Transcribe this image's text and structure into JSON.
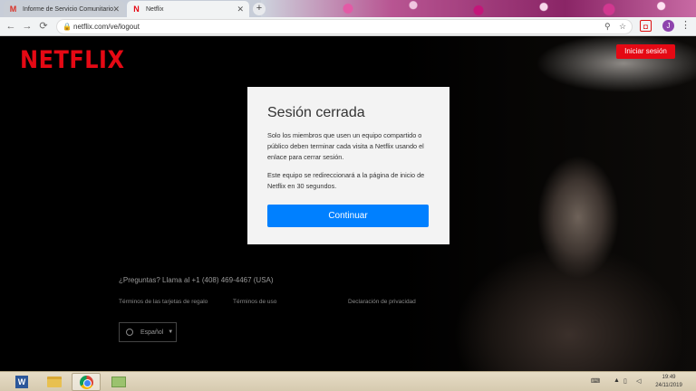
{
  "browser": {
    "tabs": [
      {
        "label": "Informe de Servicio Comunitario",
        "favicon": "M",
        "active": false
      },
      {
        "label": "Netflix",
        "favicon": "N",
        "active": true
      }
    ],
    "new_tab": "+",
    "url": "netflix.com/ve/logout",
    "nav": {
      "back": "←",
      "forward": "→",
      "reload": "⟳"
    },
    "icons": {
      "zoom": "⚲",
      "star": "☆",
      "menu": "⋮",
      "profile": "J"
    }
  },
  "page": {
    "logo": "NETFLIX",
    "signin_button": "Iniciar sesión",
    "card": {
      "title": "Sesión cerrada",
      "paragraph1": "Solo los miembros que usen un equipo compartido o público deben terminar cada visita a Netflix usando el enlace para cerrar sesión.",
      "paragraph2": "Este equipo se redireccionará a la página de inicio de Netflix en 30 segundos.",
      "button": "Continuar"
    },
    "footer": {
      "question": "¿Preguntas? Llama al +1 (408) 469-4467 (USA)",
      "links": [
        "Términos de las tarjetas de regalo",
        "Términos de uso",
        "Declaración de privacidad"
      ],
      "language": "Español"
    }
  },
  "taskbar": {
    "apps": [
      "word",
      "file-explorer",
      "chrome",
      "sticky-notes"
    ],
    "clock_time": "19:49",
    "clock_date": "24/11/2019"
  },
  "colors": {
    "netflix_red": "#e50914",
    "button_blue": "#0080ff"
  }
}
